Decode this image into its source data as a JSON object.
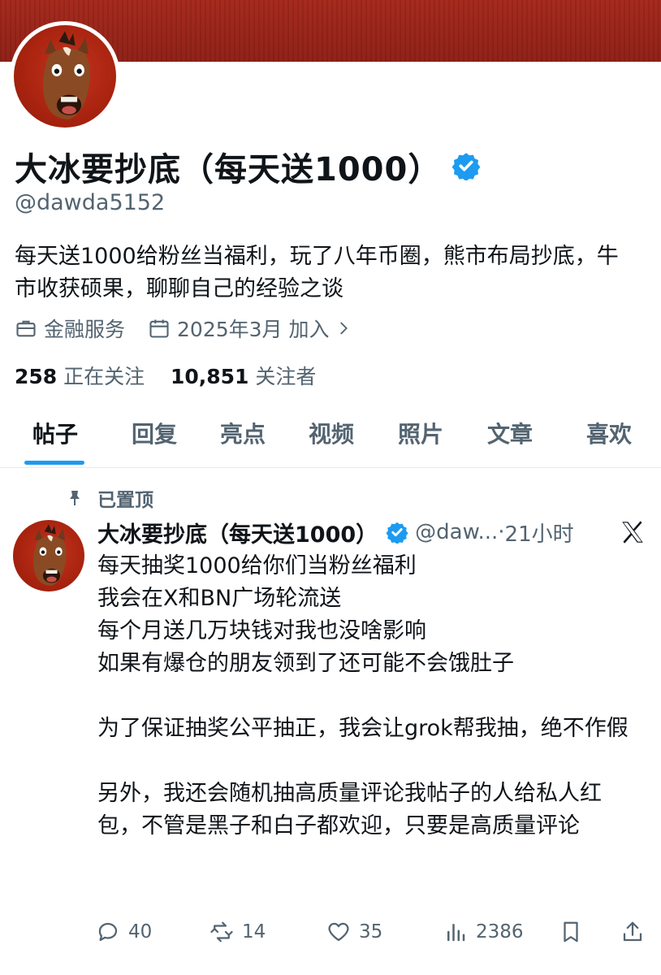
{
  "profile": {
    "name": "大冰要抄底（每天送1000）",
    "handle": "@dawda5152",
    "bio": "每天送1000给粉丝当福利，玩了八年币圈，熊市布局抄底，牛市收获硕果，聊聊自己的经验之谈",
    "category": "金融服务",
    "joined": "2025年3月 加入",
    "following_count": "258",
    "following_label": "正在关注",
    "followers_count": "10,851",
    "followers_label": "关注者"
  },
  "tabs": [
    "帖子",
    "回复",
    "亮点",
    "视频",
    "照片",
    "文章",
    "喜欢"
  ],
  "active_tab": "帖子",
  "post": {
    "pinned_label": "已置顶",
    "author_name": "大冰要抄底（每天送1000）",
    "author_handle": "@daw...",
    "separator": "·",
    "time": "21小时",
    "body": "每天抽奖1000给你们当粉丝福利\n我会在X和BN广场轮流送\n每个月送几万块钱对我也没啥影响\n如果有爆仓的朋友领到了还可能不会饿肚子\n\n为了保证抽奖公平抽正，我会让grok帮我抽，绝不作假\n\n另外，我还会随机抽高质量评论我帖子的人给私人红包，不管是黑子和白子都欢迎，只要是高质量评论",
    "replies": "40",
    "reposts": "14",
    "likes": "35",
    "views": "2386"
  },
  "colors": {
    "banner": "#9a2418",
    "accent": "#1d9bf0",
    "text": "#0f1419",
    "muted": "#536471"
  },
  "icons": [
    "briefcase-icon",
    "calendar-icon",
    "chevron-right-icon",
    "verified-badge-icon",
    "pin-icon",
    "x-logo-icon",
    "reply-icon",
    "repost-icon",
    "like-icon",
    "views-icon",
    "bookmark-icon",
    "share-icon"
  ]
}
